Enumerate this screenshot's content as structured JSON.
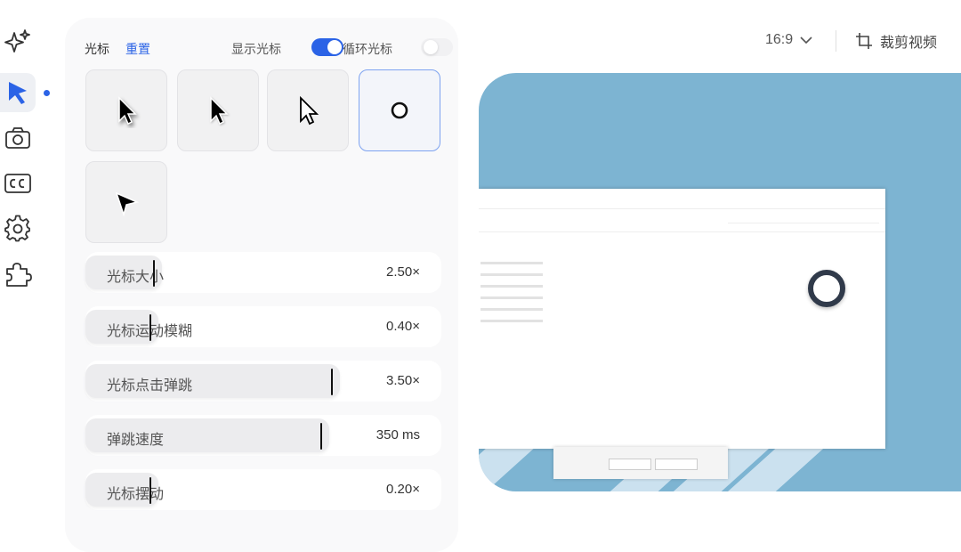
{
  "rail": {
    "icons": [
      "sparkle-icon",
      "cursor-icon",
      "camera-icon",
      "captions-icon",
      "gear-icon",
      "puzzle-icon"
    ],
    "active": "cursor-icon",
    "accent": "#2b63e6"
  },
  "panel": {
    "title": "光标",
    "reset_label": "重置",
    "show_cursor_label": "显示光标",
    "show_cursor_on": true,
    "loop_cursor_label": "循环光标",
    "loop_cursor_on": false,
    "cursor_styles": [
      "arrow-black-shadow",
      "arrow-black",
      "arrow-outline",
      "circle-dot",
      "pointer-triangle"
    ],
    "selected_style": "circle-dot",
    "sliders": [
      {
        "label": "光标大小",
        "value": "2.50×",
        "fraction": 0.19
      },
      {
        "label": "光标运动模糊",
        "value": "0.40×",
        "fraction": 0.18
      },
      {
        "label": "光标点击弹跳",
        "value": "3.50×",
        "fraction": 0.69
      },
      {
        "label": "弹跳速度",
        "value": "350 ms",
        "fraction": 0.66
      },
      {
        "label": "光标摆动",
        "value": "0.20×",
        "fraction": 0.18
      }
    ]
  },
  "toolbar": {
    "aspect_ratio": "16:9",
    "crop_label": "裁剪视频"
  }
}
